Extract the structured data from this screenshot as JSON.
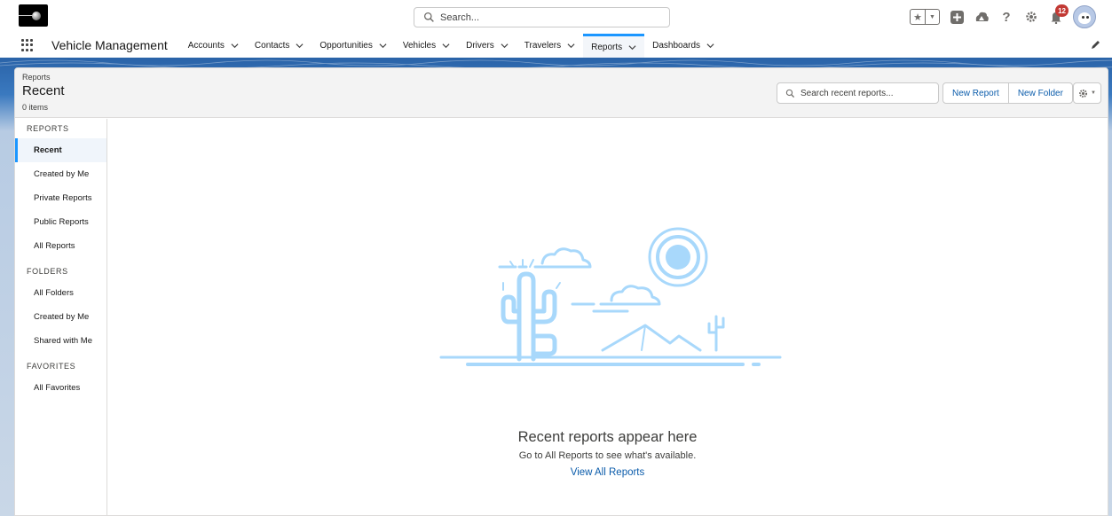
{
  "header": {
    "search_placeholder": "Search...",
    "notification_count": "12"
  },
  "nav": {
    "app_name": "Vehicle Management",
    "items": [
      {
        "label": "Accounts"
      },
      {
        "label": "Contacts"
      },
      {
        "label": "Opportunities"
      },
      {
        "label": "Vehicles"
      },
      {
        "label": "Drivers"
      },
      {
        "label": "Travelers"
      },
      {
        "label": "Reports",
        "active": true
      },
      {
        "label": "Dashboards"
      }
    ]
  },
  "page_header": {
    "object_label": "Reports",
    "title": "Recent",
    "item_count": "0 items",
    "search_placeholder": "Search recent reports...",
    "new_report_label": "New Report",
    "new_folder_label": "New Folder"
  },
  "sidebar": {
    "reports_heading": "REPORTS",
    "reports_items": [
      {
        "label": "Recent",
        "active": true
      },
      {
        "label": "Created by Me"
      },
      {
        "label": "Private Reports"
      },
      {
        "label": "Public Reports"
      },
      {
        "label": "All Reports"
      }
    ],
    "folders_heading": "FOLDERS",
    "folders_items": [
      {
        "label": "All Folders"
      },
      {
        "label": "Created by Me"
      },
      {
        "label": "Shared with Me"
      }
    ],
    "favorites_heading": "FAVORITES",
    "favorites_items": [
      {
        "label": "All Favorites"
      }
    ]
  },
  "empty_state": {
    "title": "Recent reports appear here",
    "subtitle": "Go to All Reports to see what's available.",
    "link": "View All Reports"
  },
  "colors": {
    "accent": "#1b96ff",
    "link": "#0b5cab",
    "illustration": "#a8d8fb",
    "badge": "#c23934"
  }
}
